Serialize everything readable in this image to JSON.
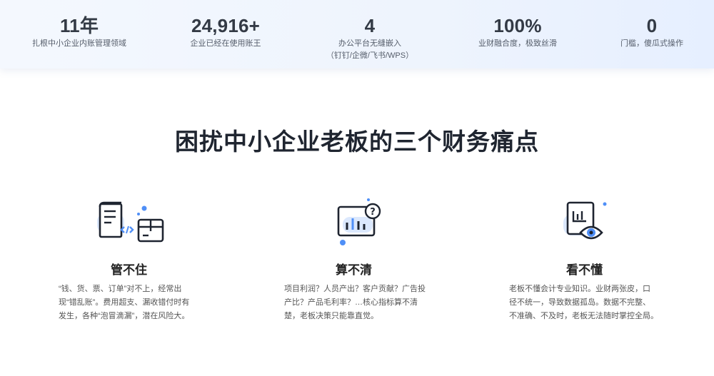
{
  "stats": [
    {
      "value": "11年",
      "label": "扎根中小企业内账管理领域",
      "sublabel": ""
    },
    {
      "value": "24,916+",
      "label": "企业已经在使用账王",
      "sublabel": ""
    },
    {
      "value": "4",
      "label": "办公平台无缝嵌入",
      "sublabel": "（钉钉/企微/飞书/WPS）"
    },
    {
      "value": "100%",
      "label": "业财融合度，极致丝滑",
      "sublabel": ""
    },
    {
      "value": "0",
      "label": "门槛，傻瓜式操作",
      "sublabel": ""
    }
  ],
  "section": {
    "title": "困扰中小企业老板的三个财务痛点"
  },
  "cards": [
    {
      "icon": "document-box-icon",
      "title": "管不住",
      "desc_lines": [
        "“钱、货、票、订单”对不上，经常出",
        "现“错乱账”。费用超支、漏收错付时有",
        "发生，各种“泡冒滴漏”，潜在风险大。"
      ]
    },
    {
      "icon": "chart-question-icon",
      "title": "算不清",
      "desc_lines": [
        "项目利润？人员产出？客户贡献？广告投",
        "产比？产品毛利率？…核心指标算不清",
        "楚，老板决策只能靠直觉。"
      ]
    },
    {
      "icon": "report-eye-icon",
      "title": "看不懂",
      "desc_lines": [
        "老板不懂会计专业知识。业财两张皮，口",
        "径不统一，导致数据孤岛。数据不完整、",
        "不准确、不及时，老板无法随时掌控全局。"
      ]
    }
  ],
  "colors": {
    "accent_blue": "#4f8ff7",
    "light_blue": "#dbe8fd",
    "icon_stroke": "#1e2430"
  }
}
